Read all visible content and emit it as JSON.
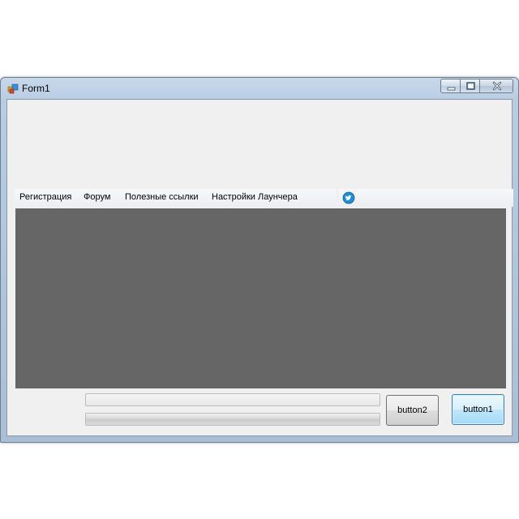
{
  "window": {
    "title": "Form1",
    "controls": {
      "minimize_icon": "minimize-icon",
      "maximize_icon": "maximize-icon",
      "close_icon": "close-icon"
    }
  },
  "menu": {
    "items": [
      {
        "label": "Регистрация"
      },
      {
        "label": "Форум"
      },
      {
        "label": "Полезные ссылки"
      },
      {
        "label": "Настройки Лаунчера"
      }
    ],
    "icon": "twitter-icon"
  },
  "progress": {
    "top_value": 0,
    "bottom_value": 1.0
  },
  "buttons": {
    "button2_label": "button2",
    "button1_label": "button1"
  },
  "colors": {
    "panel": "#666666",
    "client_bg": "#f0f0f0",
    "menu_icon": "#1e8fd6"
  }
}
